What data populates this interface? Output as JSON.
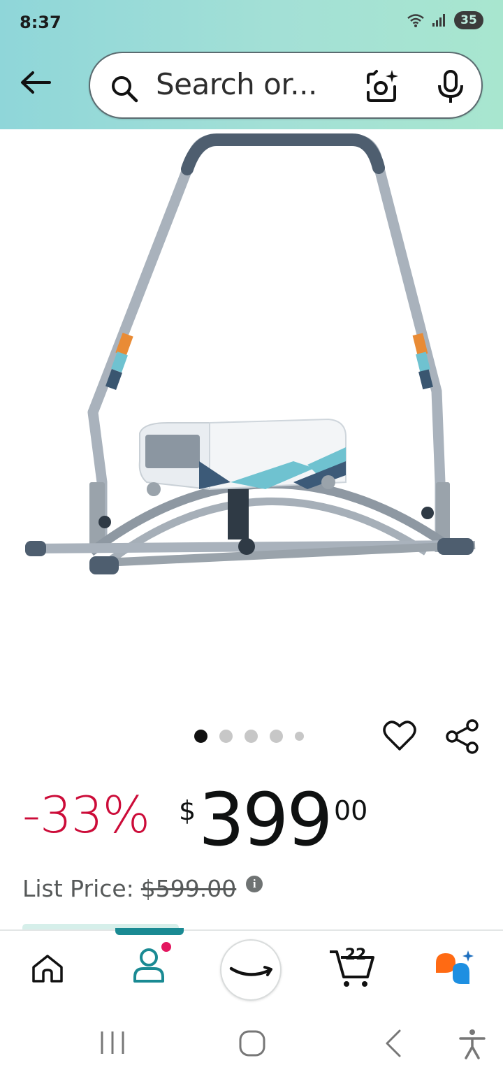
{
  "status_bar": {
    "time": "8:37",
    "battery": "35",
    "icons": [
      "wifi-icon",
      "signal-icon",
      "battery-icon"
    ]
  },
  "header": {
    "back_icon": "back-arrow-icon",
    "search": {
      "placeholder": "Search or...",
      "icons": [
        "search-icon",
        "camera-lens-icon",
        "microphone-icon"
      ]
    }
  },
  "product": {
    "image_icon": "product-photo",
    "carousel": {
      "count": 5,
      "active_index": 0
    },
    "actions": [
      "heart-icon",
      "share-icon"
    ],
    "discount": "-33%",
    "price": {
      "symbol": "$",
      "whole": "399",
      "fraction": "00"
    },
    "list_price": {
      "label": "List Price:",
      "value": "$599.00"
    },
    "info_icon": "i"
  },
  "bottom_nav": {
    "items": [
      {
        "name": "home",
        "icon": "home-icon"
      },
      {
        "name": "account",
        "icon": "person-icon",
        "has_notification": true
      },
      {
        "name": "amazon",
        "icon": "amazon-smile-icon"
      },
      {
        "name": "cart",
        "icon": "cart-icon",
        "count": "22"
      },
      {
        "name": "rufus",
        "icon": "rufus-icon"
      }
    ],
    "active": "account",
    "accent_color": "#1a8a93"
  },
  "system_nav": [
    "recents-icon",
    "home-circle-icon",
    "back-chevron-icon",
    "accessibility-icon"
  ],
  "colors": {
    "discount": "#cc0c39",
    "header_gradient_start": "#8fd6d9",
    "header_gradient_end": "#a8e6cf",
    "notification_dot": "#e3175f"
  }
}
